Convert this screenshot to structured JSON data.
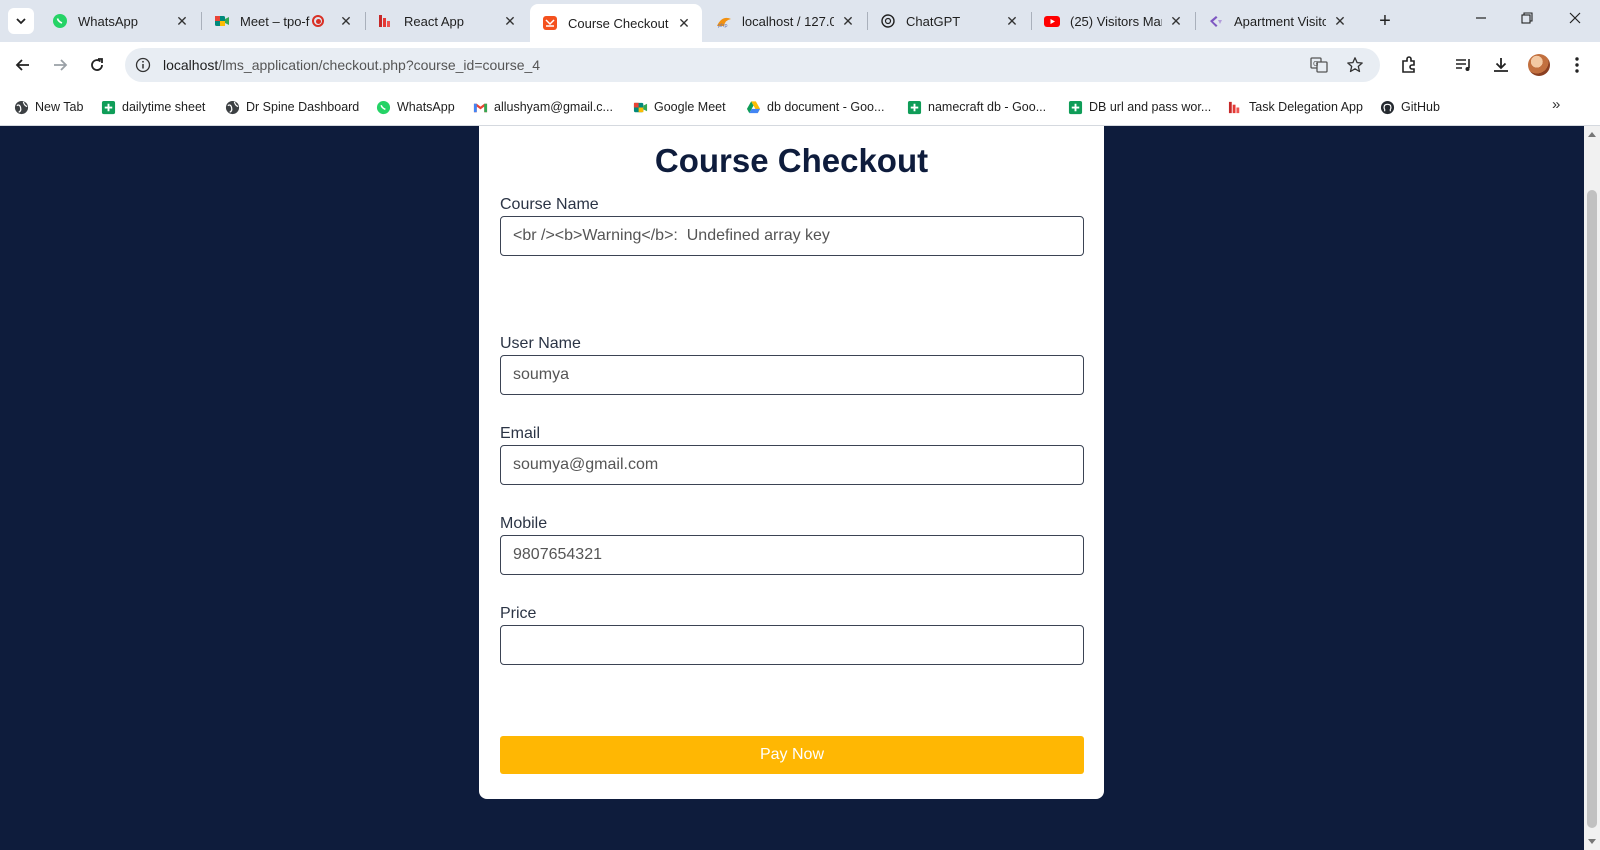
{
  "browser": {
    "tabs": [
      {
        "title": "WhatsApp",
        "icon": "whatsapp-icon"
      },
      {
        "title": "Meet – tpo-f",
        "icon": "google-meet-icon",
        "recording": true
      },
      {
        "title": "React App",
        "icon": "react-app-icon"
      },
      {
        "title": "Course Checkout",
        "icon": "course-checkout-icon",
        "active": true
      },
      {
        "title": "localhost / 127.0",
        "icon": "phpmyadmin-icon"
      },
      {
        "title": "ChatGPT",
        "icon": "chatgpt-icon"
      },
      {
        "title": "(25) Visitors Man",
        "icon": "youtube-icon"
      },
      {
        "title": "Apartment Visito",
        "icon": "apartment-icon"
      }
    ],
    "url_host": "localhost",
    "url_path": "/lms_application/checkout.php?course_id=course_4",
    "bookmarks": [
      {
        "label": "New Tab",
        "icon": "globe-icon"
      },
      {
        "label": "dailytime sheet",
        "icon": "sheets-icon"
      },
      {
        "label": "Dr Spine Dashboard",
        "icon": "globe-icon"
      },
      {
        "label": "WhatsApp",
        "icon": "whatsapp-icon"
      },
      {
        "label": "allushyam@gmail.c...",
        "icon": "gmail-icon"
      },
      {
        "label": "Google Meet",
        "icon": "google-meet-icon"
      },
      {
        "label": "db document - Goo...",
        "icon": "drive-icon"
      },
      {
        "label": "namecraft db - Goo...",
        "icon": "sheets-icon"
      },
      {
        "label": "DB url and pass wor...",
        "icon": "sheets-icon"
      },
      {
        "label": "Task Delegation App",
        "icon": "task-app-icon"
      },
      {
        "label": "GitHub",
        "icon": "github-icon"
      }
    ]
  },
  "checkout": {
    "title": "Course Checkout",
    "course_name_label": "Course Name",
    "course_name_value": "<br /><b>Warning</b>:  Undefined array key",
    "user_name_label": "User Name",
    "user_name_value": "soumya",
    "email_label": "Email",
    "email_value": "soumya@gmail.com",
    "mobile_label": "Mobile",
    "mobile_value": "9807654321",
    "price_label": "Price",
    "price_value": "",
    "pay_button": "Pay Now"
  },
  "colors": {
    "page_background": "#0e1c3c",
    "title": "#0e1c3c",
    "pay_button": "#ffb703"
  }
}
